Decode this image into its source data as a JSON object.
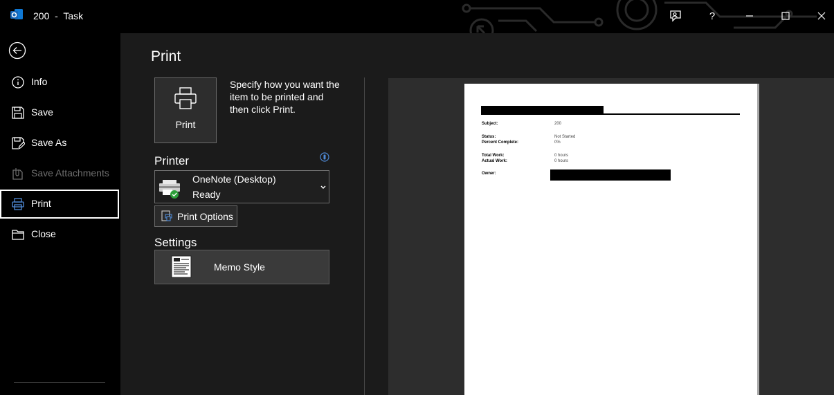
{
  "window": {
    "title": "200  -  Task",
    "app_icon": "outlook-icon",
    "controls": [
      "feedback-icon",
      "help-icon",
      "minimize-icon",
      "maximize-icon",
      "close-icon"
    ],
    "help_label": "?"
  },
  "sidebar": {
    "back_icon": "back-arrow-icon",
    "items": [
      {
        "label": "Info",
        "icon": "info-icon"
      },
      {
        "label": "Save",
        "icon": "save-icon"
      },
      {
        "label": "Save As",
        "icon": "save-as-icon"
      },
      {
        "label": "Save Attachments",
        "icon": "save-attachments-icon",
        "disabled": true
      },
      {
        "label": "Print",
        "icon": "print-icon",
        "selected": true
      },
      {
        "label": "Close",
        "icon": "folder-close-icon"
      }
    ]
  },
  "main": {
    "title": "Print",
    "print_button": {
      "label": "Print",
      "icon": "printer-icon"
    },
    "description": "Specify how you want the item to be printed and then click Print.",
    "printer": {
      "heading": "Printer",
      "name": "OneNote (Desktop)",
      "status": "Ready",
      "status_color": "#2e9e3a"
    },
    "print_options": {
      "label": "Print Options",
      "icon": "print-options-icon"
    },
    "settings": {
      "heading": "Settings",
      "style": "Memo Style",
      "style_icon": "memo-style-icon"
    }
  },
  "preview": {
    "fields": [
      {
        "label": "Subject:",
        "value": "200"
      },
      {
        "label": "Status:",
        "value": "Not Started"
      },
      {
        "label": "Percent Complete:",
        "value": "0%"
      },
      {
        "label": "Total Work:",
        "value": "0 hours"
      },
      {
        "label": "Actual Work:",
        "value": "0 hours"
      },
      {
        "label": "Owner:",
        "value": ""
      }
    ]
  },
  "colors": {
    "background": "#000000",
    "panel": "#1b1b1b",
    "accent": "#4f8ad6"
  }
}
